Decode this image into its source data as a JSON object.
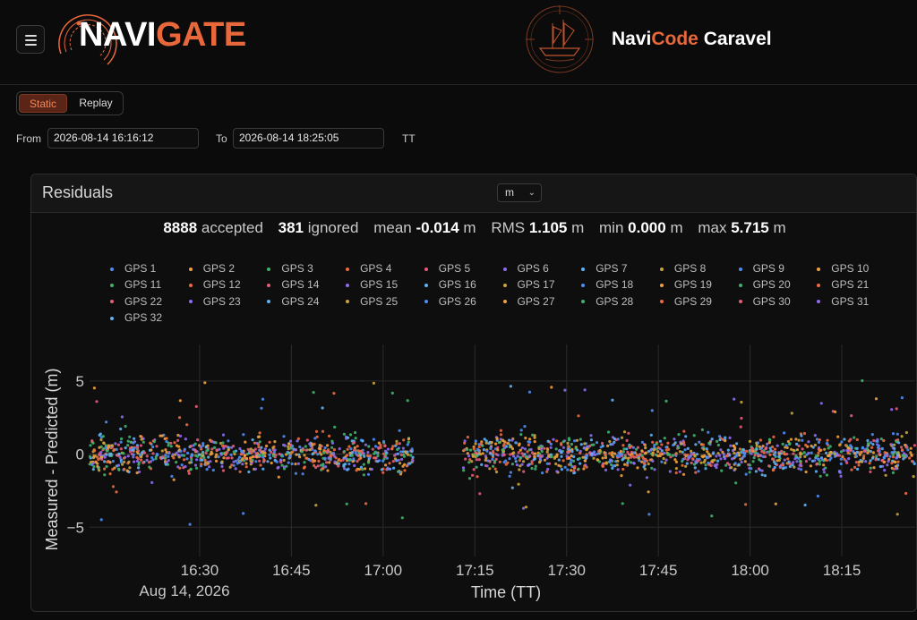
{
  "header": {
    "logo_white": "NAVI",
    "logo_orange": "GATE",
    "brand_white1": "Navi",
    "brand_orange": "Code",
    "brand_white2": " Caravel"
  },
  "controls": {
    "mode_options": [
      "Static",
      "Replay"
    ],
    "mode_selected": "Static",
    "from_label": "From",
    "from_value": "2026-08-14 16:16:12",
    "to_label": "To",
    "to_value": "2026-08-14 18:25:05",
    "timescale": "TT"
  },
  "panel": {
    "title": "Residuals",
    "unit": "m",
    "stats": {
      "accepted": "8888",
      "accepted_label": "accepted",
      "ignored": "381",
      "ignored_label": "ignored",
      "mean_label": "mean",
      "mean": "-0.014",
      "mean_unit": "m",
      "rms_label": "RMS",
      "rms": "1.105",
      "rms_unit": "m",
      "min_label": "min",
      "min": "0.000",
      "min_unit": "m",
      "max_label": "max",
      "max": "5.715",
      "max_unit": "m"
    }
  },
  "colors": {
    "accent": "#e8683b",
    "series_palette": [
      "#4c8df6",
      "#f2a03d",
      "#3fb36b",
      "#ef6a3e",
      "#e75b7b",
      "#8e6bf0",
      "#5fb3f5",
      "#c9a43a"
    ]
  },
  "chart_data": {
    "type": "scatter",
    "ylabel": "Measured - Predicted (m)",
    "xlabel": "Time (TT)",
    "x_date_label": "Aug 14, 2026",
    "x_tick_labels": [
      "16:30",
      "16:45",
      "17:00",
      "17:15",
      "17:30",
      "17:45",
      "18:00",
      "18:15"
    ],
    "x_range": [
      "2026-08-14 16:16:12",
      "2026-08-14 18:25:05"
    ],
    "y_tick_labels": [
      "5",
      "0",
      "−5"
    ],
    "ylim": [
      -7,
      7.5
    ],
    "data_gap": [
      "2026-08-14 17:05",
      "2026-08-14 17:13"
    ],
    "grid": true,
    "legend_position": "top",
    "series": [
      {
        "name": "GPS 1"
      },
      {
        "name": "GPS 2"
      },
      {
        "name": "GPS 3"
      },
      {
        "name": "GPS 4"
      },
      {
        "name": "GPS 5"
      },
      {
        "name": "GPS 6"
      },
      {
        "name": "GPS 7"
      },
      {
        "name": "GPS 8"
      },
      {
        "name": "GPS 9"
      },
      {
        "name": "GPS 10"
      },
      {
        "name": "GPS 11"
      },
      {
        "name": "GPS 12"
      },
      {
        "name": "GPS 14"
      },
      {
        "name": "GPS 15"
      },
      {
        "name": "GPS 16"
      },
      {
        "name": "GPS 17"
      },
      {
        "name": "GPS 18"
      },
      {
        "name": "GPS 19"
      },
      {
        "name": "GPS 20"
      },
      {
        "name": "GPS 21"
      },
      {
        "name": "GPS 22"
      },
      {
        "name": "GPS 23"
      },
      {
        "name": "GPS 24"
      },
      {
        "name": "GPS 25"
      },
      {
        "name": "GPS 26"
      },
      {
        "name": "GPS 27"
      },
      {
        "name": "GPS 28"
      },
      {
        "name": "GPS 29"
      },
      {
        "name": "GPS 30"
      },
      {
        "name": "GPS 31"
      },
      {
        "name": "GPS 32"
      }
    ]
  }
}
